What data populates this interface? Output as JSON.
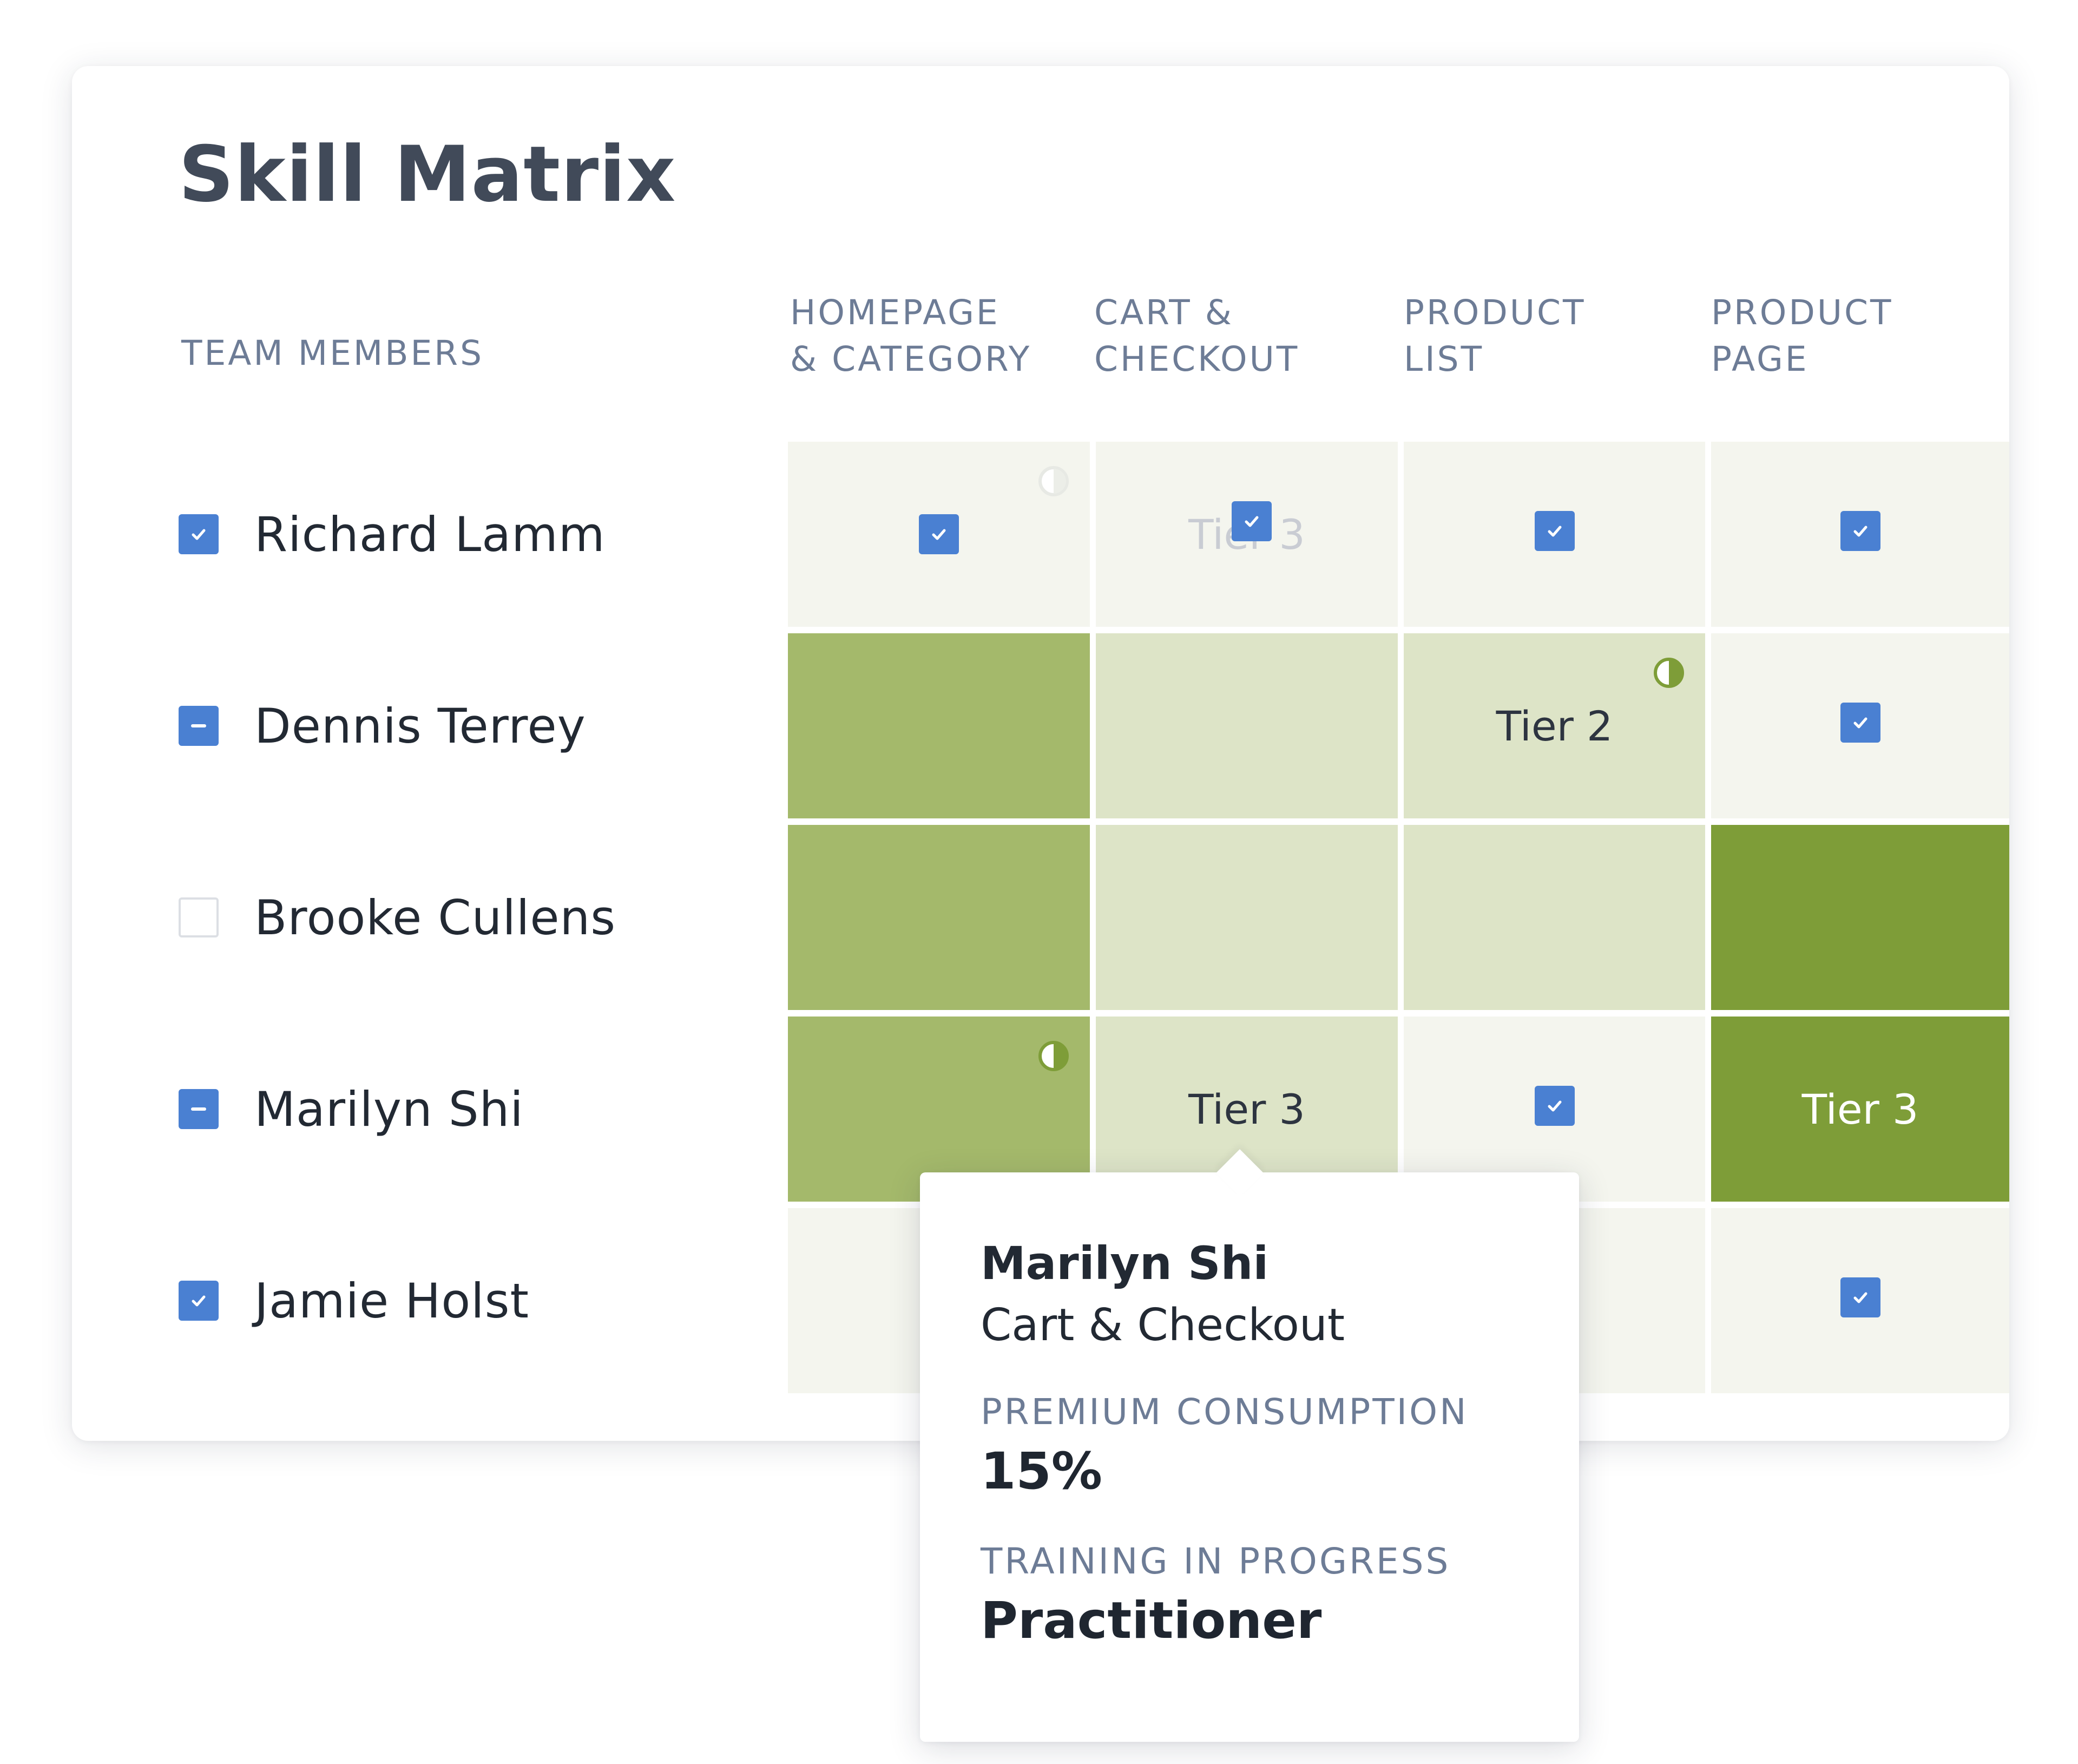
{
  "title": "Skill Matrix",
  "colors": {
    "title": "#414a59",
    "header": "#6d7c96",
    "checkbox_blue": "#4a80d2",
    "level_0": "#f4f5ee",
    "level_1": "#dde4c7",
    "level_2": "#a4b96b",
    "level_3": "#7e9d38",
    "ring_green": "#7e9d38"
  },
  "columns": [
    {
      "line1": "HOMEPAGE",
      "line2": "& CATEGORY"
    },
    {
      "line1": "CART &",
      "line2": "CHECKOUT"
    },
    {
      "line1": "PRODUCT",
      "line2": "LIST"
    },
    {
      "line1": "PRODUCT",
      "line2": "PAGE"
    }
  ],
  "members_header": "TEAM MEMBERS",
  "members": [
    {
      "name": "Richard Lamm",
      "checkbox": "checked",
      "cells": [
        {
          "level": 0,
          "icon": "checkbox-icon",
          "training": "faded-ring"
        },
        {
          "level": 0,
          "icon": "checkbox-icon",
          "text": "Tier 3",
          "text_faded": true
        },
        {
          "level": 0,
          "icon": "checkbox-icon"
        },
        {
          "level": 0,
          "icon": "checkbox-icon"
        }
      ]
    },
    {
      "name": "Dennis Terrey",
      "checkbox": "partial",
      "cells": [
        {
          "level": 2
        },
        {
          "level": 1
        },
        {
          "level": 1,
          "text": "Tier 2",
          "training": "ring"
        },
        {
          "level": 0,
          "icon": "checkbox-icon"
        }
      ]
    },
    {
      "name": "Brooke Cullens",
      "checkbox": "unchecked",
      "cells": [
        {
          "level": 2
        },
        {
          "level": 1
        },
        {
          "level": 1
        },
        {
          "level": 3
        }
      ]
    },
    {
      "name": "Marilyn Shi",
      "checkbox": "partial",
      "cells": [
        {
          "level": 2,
          "training": "ring"
        },
        {
          "level": 1,
          "text": "Tier 3"
        },
        {
          "level": 0,
          "icon": "checkbox-icon"
        },
        {
          "level": 3,
          "text": "Tier 3"
        }
      ]
    },
    {
      "name": "Jamie Holst",
      "checkbox": "checked",
      "cells": [
        {
          "level": 0
        },
        {
          "level": 0
        },
        {
          "level": 0
        },
        {
          "level": 0,
          "icon": "checkbox-icon"
        }
      ]
    }
  ],
  "tooltip": {
    "name": "Marilyn Shi",
    "skill": "Cart & Checkout",
    "label1": "PREMIUM CONSUMPTION",
    "value1": "15%",
    "label2": "TRAINING IN PROGRESS",
    "value2": "Practitioner"
  }
}
